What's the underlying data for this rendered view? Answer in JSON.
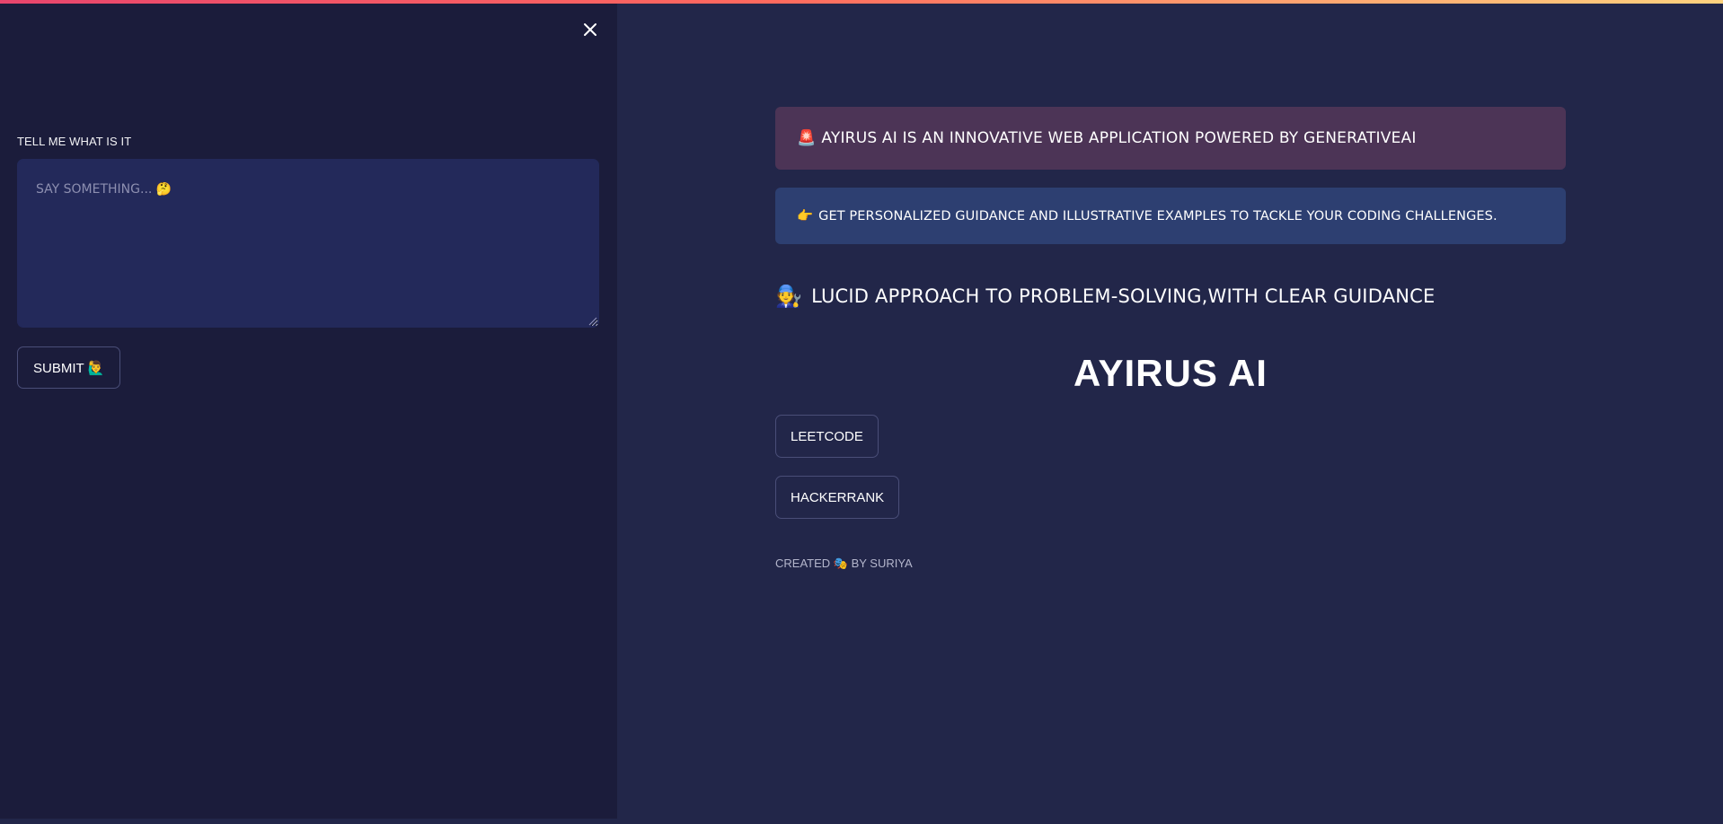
{
  "sidebar": {
    "close_label": "×",
    "prompt_label": "TELL ME WHAT IS IT",
    "prompt_placeholder": "SAY SOMETHING... 🤔",
    "submit_label": "SUBMIT 🙋‍♂️"
  },
  "main": {
    "alerts": [
      {
        "icon": "🚨",
        "text": "AYIRUS AI IS AN INNOVATIVE WEB APPLICATION POWERED BY GENERATIVEAI",
        "style": "error"
      },
      {
        "icon": "👉",
        "text": "GET PERSONALIZED GUIDANCE AND ILLUSTRATIVE EXAMPLES TO TACKLE YOUR CODING CHALLENGES.",
        "style": "info"
      }
    ],
    "subheading": {
      "icon": "🧑‍🔧",
      "text": "LUCID APPROACH TO PROBLEM-SOLVING,WITH CLEAR GUIDANCE"
    },
    "title": "AYIRUS AI",
    "buttons": [
      {
        "label": "LEETCODE"
      },
      {
        "label": "HACKERRANK"
      }
    ],
    "credit": "CREATED 🎭 BY SURIYA"
  },
  "theme": {
    "sidebar_bg": "#1b1c3b",
    "main_bg": "#222649",
    "input_bg": "#23295a",
    "alert_error_bg": "#4c3456",
    "alert_info_bg": "#2d3f71",
    "accent_gradient": [
      "#e8456d",
      "#ff6a5e",
      "#ffd27e"
    ]
  }
}
